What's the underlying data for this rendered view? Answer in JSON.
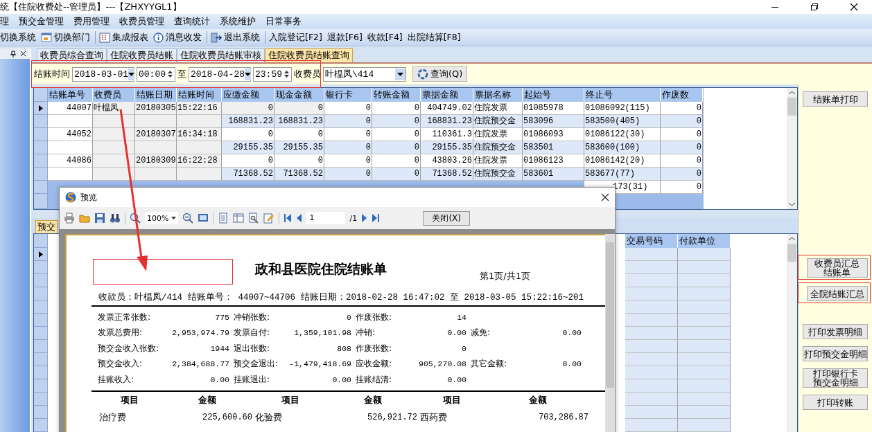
{
  "window": {
    "title": "统【住院收费处--管理员】---【ZHXYYGL1】"
  },
  "menu": [
    "理",
    "预交金管理",
    "费用管理",
    "收费员管理",
    "查询统计",
    "系统维护",
    "日常事务"
  ],
  "toolbar": [
    [
      {
        "label": "切换系统"
      },
      {
        "label": "切换部门"
      }
    ],
    [
      {
        "label": "集成报表"
      },
      {
        "label": "消息收发"
      }
    ],
    [
      {
        "label": "退出系统"
      }
    ],
    [
      {
        "label": "入院登记[F2]"
      },
      {
        "label": "退款[F6]"
      },
      {
        "label": "收款[F4]"
      },
      {
        "label": "出院结算[F8]"
      }
    ]
  ],
  "tabs": [
    {
      "label": "收费员综合查询",
      "selected": false
    },
    {
      "label": "住院收费员结账",
      "selected": false
    },
    {
      "label": "住院收费员结账审核",
      "selected": false
    },
    {
      "label": "住院收费员结账查询",
      "selected": true
    }
  ],
  "filter": {
    "annotated": true,
    "label": "结账时间",
    "from_date": "2018-03-01",
    "from_time": "00:00",
    "to_label": "至",
    "to_date": "2018-04-28",
    "to_time": "23:59",
    "collector_label": "收费员",
    "collector": "叶榅凤\\414",
    "query_button": "查询(Q)"
  },
  "grid": {
    "columns": [
      "结账单号",
      "收费员",
      "结账日期",
      "结账时间",
      "应缴金额",
      "现金金额",
      "银行卡",
      "转账金额",
      "票据金额",
      "票据名称",
      "起始号",
      "终止号",
      "作废数"
    ],
    "rows": [
      {
        "kind": "main",
        "selected": true,
        "cells": [
          "44007",
          "叶榅凤",
          "20180305",
          "15:22:16",
          "0",
          "0",
          "0",
          "0",
          "404749.02",
          "住院发票",
          "01085978",
          "01086092(115)",
          "0"
        ]
      },
      {
        "kind": "sub",
        "selected": false,
        "cells": [
          null,
          null,
          null,
          null,
          "168831.23",
          "168831.23",
          "0",
          "0",
          "168831.23",
          "住院预交金",
          "583096",
          "583500(405)",
          "0"
        ]
      },
      {
        "kind": "main",
        "selected": false,
        "cells": [
          "44052",
          null,
          "20180307",
          "16:34:18",
          "0",
          "0",
          "0",
          "0",
          "110361.3",
          "住院发票",
          "01086093",
          "01086122(30)",
          "0"
        ]
      },
      {
        "kind": "sub",
        "selected": false,
        "cells": [
          null,
          null,
          null,
          null,
          "29155.35",
          "29155.35",
          "0",
          "0",
          "29155.35",
          "住院预交金",
          "583501",
          "583600(100)",
          "0"
        ]
      },
      {
        "kind": "main",
        "selected": false,
        "cells": [
          "44086",
          null,
          "20180309",
          "16:22:28",
          "0",
          "0",
          "0",
          "0",
          "43803.26",
          "住院发票",
          "01086123",
          "01086142(20)",
          "0"
        ]
      },
      {
        "kind": "sub",
        "selected": false,
        "cells": [
          null,
          null,
          null,
          null,
          "71368.52",
          "71368.52",
          "0",
          "0",
          "71368.52",
          "住院预交金",
          "583601",
          "583677(77)",
          "0"
        ]
      },
      {
        "kind": "covered",
        "selected": false,
        "cells": [
          null,
          null,
          null,
          null,
          null,
          null,
          null,
          null,
          null,
          null,
          null,
          "173(31)",
          "0"
        ]
      }
    ]
  },
  "actions_top": [
    {
      "lines": [
        "结账单打印"
      ],
      "annotated": false
    }
  ],
  "actions": [
    {
      "lines": [
        "收费员汇总",
        "结账单"
      ],
      "annotated": true
    },
    {
      "lines": [
        "全院结账汇总"
      ],
      "annotated": true
    },
    {
      "lines": [
        "打印发票明细"
      ],
      "annotated": false
    },
    {
      "lines": [
        "打印预交金明细"
      ],
      "annotated": false
    },
    {
      "lines": [
        "打印银行卡",
        "预交金明细"
      ],
      "annotated": false
    },
    {
      "lines": [
        "打印转账"
      ],
      "annotated": false
    }
  ],
  "lower": {
    "tab": "预交",
    "columns": [
      "交易号码",
      "付款单位"
    ],
    "rows": [
      {
        "selected": true
      },
      {
        "selected": false
      },
      {
        "selected": false
      },
      {
        "selected": false
      },
      {
        "selected": false
      },
      {
        "selected": false
      },
      {
        "selected": false
      },
      {
        "selected": false
      },
      {
        "selected": false
      },
      {
        "selected": false
      },
      {
        "selected": false
      },
      {
        "selected": false
      },
      {
        "selected": false
      },
      {
        "selected": false
      }
    ]
  },
  "preview": {
    "title": "预览",
    "zoom": "100%",
    "page": "1",
    "page_total": "/1",
    "close_button": "关闭(X)",
    "report": {
      "title": "政和县医院住院结账单",
      "page_info": "第1页/共1页",
      "header": [
        "收款员：叶榅凤/414",
        "结账单号： 44007~44706",
        "结账日期：2018-02-28 16:47:02 至 2018-03-05 15:22:16~201"
      ],
      "stats": [
        [
          {
            "label": "发票正常张数:",
            "value": "775"
          },
          {
            "label": "冲销张数:",
            "value": "0"
          },
          {
            "label": "作废张数:",
            "value": "14"
          }
        ],
        [
          {
            "label": "发票总费用:",
            "value": "2,953,974.79"
          },
          {
            "label": "发票自付:",
            "value": "1,359,101.98"
          },
          {
            "label": "冲销:",
            "value": "0.00"
          },
          {
            "label": "减免:",
            "value": "0.00"
          }
        ],
        [
          {
            "label": "预交金收入张数:",
            "value": "1944"
          },
          {
            "label": "退出张数:",
            "value": "808"
          },
          {
            "label": "作废张数:",
            "value": "0"
          }
        ],
        [
          {
            "label": "预交金收入:",
            "value": "2,384,688.77"
          },
          {
            "label": "预交金退出:",
            "value": "-1,479,418.69"
          },
          {
            "label": "应收金额:",
            "value": "905,270.08"
          },
          {
            "label": "其它金额:",
            "value": "0.00"
          }
        ],
        [
          {
            "label": "挂账收入:",
            "value": "0.00"
          },
          {
            "label": "挂账退出:",
            "value": "0.00"
          },
          {
            "label": "挂账结清:",
            "value": "0.00"
          }
        ]
      ],
      "fee_columns": [
        "项目",
        "金额",
        "项目",
        "金额",
        "项目",
        "金额"
      ],
      "fees": [
        [
          "治疗费",
          "225,600.60",
          "化验费",
          "526,921.72",
          "西药费",
          "703,286.87"
        ]
      ]
    }
  }
}
